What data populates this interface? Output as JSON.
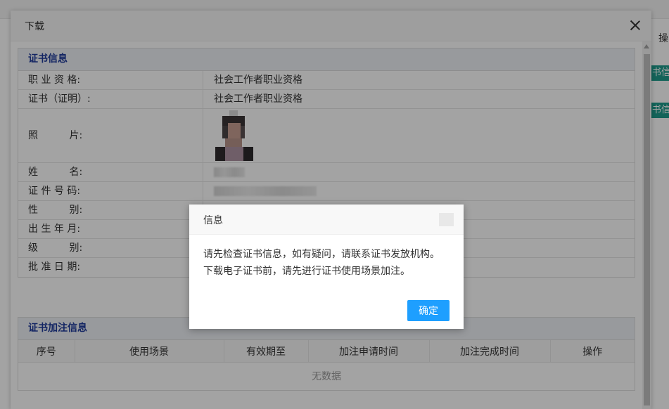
{
  "background": {
    "op_column_label": "操",
    "side_buttons": [
      "书信息",
      "书信息"
    ]
  },
  "window": {
    "title": "下载"
  },
  "certificate": {
    "section_title": "证书信息",
    "rows": [
      {
        "label": "职 业 资 格:",
        "value": "社会工作者职业资格"
      },
      {
        "label": "证书（证明）:",
        "value": "社会工作者职业资格"
      },
      {
        "label": "照          片:",
        "value": ""
      },
      {
        "label": "姓          名:",
        "value": ""
      },
      {
        "label": "证 件 号 码:",
        "value": ""
      },
      {
        "label": "性          别:",
        "value": ""
      },
      {
        "label": "出 生 年 月:",
        "value": ""
      },
      {
        "label": "级          别:",
        "value": ""
      },
      {
        "label": "批 准 日 期:",
        "value": ""
      }
    ]
  },
  "annotation": {
    "section_title": "证书加注信息",
    "columns": [
      "序号",
      "使用场景",
      "有效期至",
      "加注申请时间",
      "加注完成时间",
      "操作"
    ],
    "empty_text": "无数据"
  },
  "dialog": {
    "title": "信息",
    "message_line1": "请先检查证书信息，如有疑问，请联系证书发放机构。",
    "message_line2": "下载电子证书前，请先进行证书使用场景加注。",
    "ok_label": "确定"
  },
  "icons": {
    "window_close": "close-icon",
    "dialog_close": "close-icon",
    "scroll_up": "caret-up-icon"
  },
  "colors": {
    "section_title": "#1f3b9b",
    "primary_button": "#1e9fff",
    "side_button": "#1e9b8b"
  }
}
